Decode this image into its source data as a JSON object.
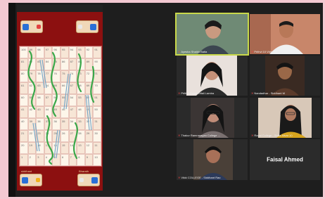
{
  "game": {
    "top_left_player": "",
    "top_right_player": "",
    "bottom_left_player": "siddhant",
    "bottom_right_player": "Bharath",
    "board_numbers": [
      [
        "100",
        "99",
        "98",
        "97",
        "96",
        "95",
        "94",
        "93",
        "92",
        "91"
      ],
      [
        "81",
        "82",
        "83",
        "84",
        "85",
        "86",
        "87",
        "88",
        "89",
        "90"
      ],
      [
        "80",
        "79",
        "78",
        "77",
        "76",
        "75",
        "74",
        "73",
        "72",
        "71"
      ],
      [
        "61",
        "62",
        "63",
        "64",
        "65",
        "66",
        "67",
        "68",
        "69",
        "70"
      ],
      [
        "60",
        "59",
        "58",
        "57",
        "56",
        "55",
        "54",
        "53",
        "52",
        "51"
      ],
      [
        "41",
        "42",
        "43",
        "44",
        "45",
        "46",
        "47",
        "48",
        "49",
        "50"
      ],
      [
        "40",
        "39",
        "38",
        "37",
        "36",
        "35",
        "34",
        "33",
        "32",
        "31"
      ],
      [
        "21",
        "22",
        "23",
        "24",
        "25",
        "26",
        "27",
        "28",
        "29",
        "30"
      ],
      [
        "20",
        "19",
        "18",
        "17",
        "16",
        "15",
        "14",
        "13",
        "12",
        "11"
      ],
      [
        "1",
        "2",
        "3",
        "4",
        "5",
        "6",
        "7",
        "8",
        "9",
        "10"
      ]
    ]
  },
  "participants": [
    {
      "name": "Ayesha Shaikh Batla"
    },
    {
      "name": "Prithvi 10 Vidya Tripathi"
    },
    {
      "name": "Pritika Gujral Mitali Lamba"
    },
    {
      "name": "Nandadhar - Siddhant M"
    },
    {
      "name": "Thakur Ramnarayan College ..."
    },
    {
      "name": "Royal College - Shilla Nivar 10"
    },
    {
      "name": "Vikki COLLEGE - Siddhant Rao"
    },
    {
      "name": "Faisal Ahmed"
    }
  ],
  "colors": {
    "active_speaker_border": "#c9d84a",
    "muted_mic": "#e44444",
    "game_background": "#8c1010"
  }
}
